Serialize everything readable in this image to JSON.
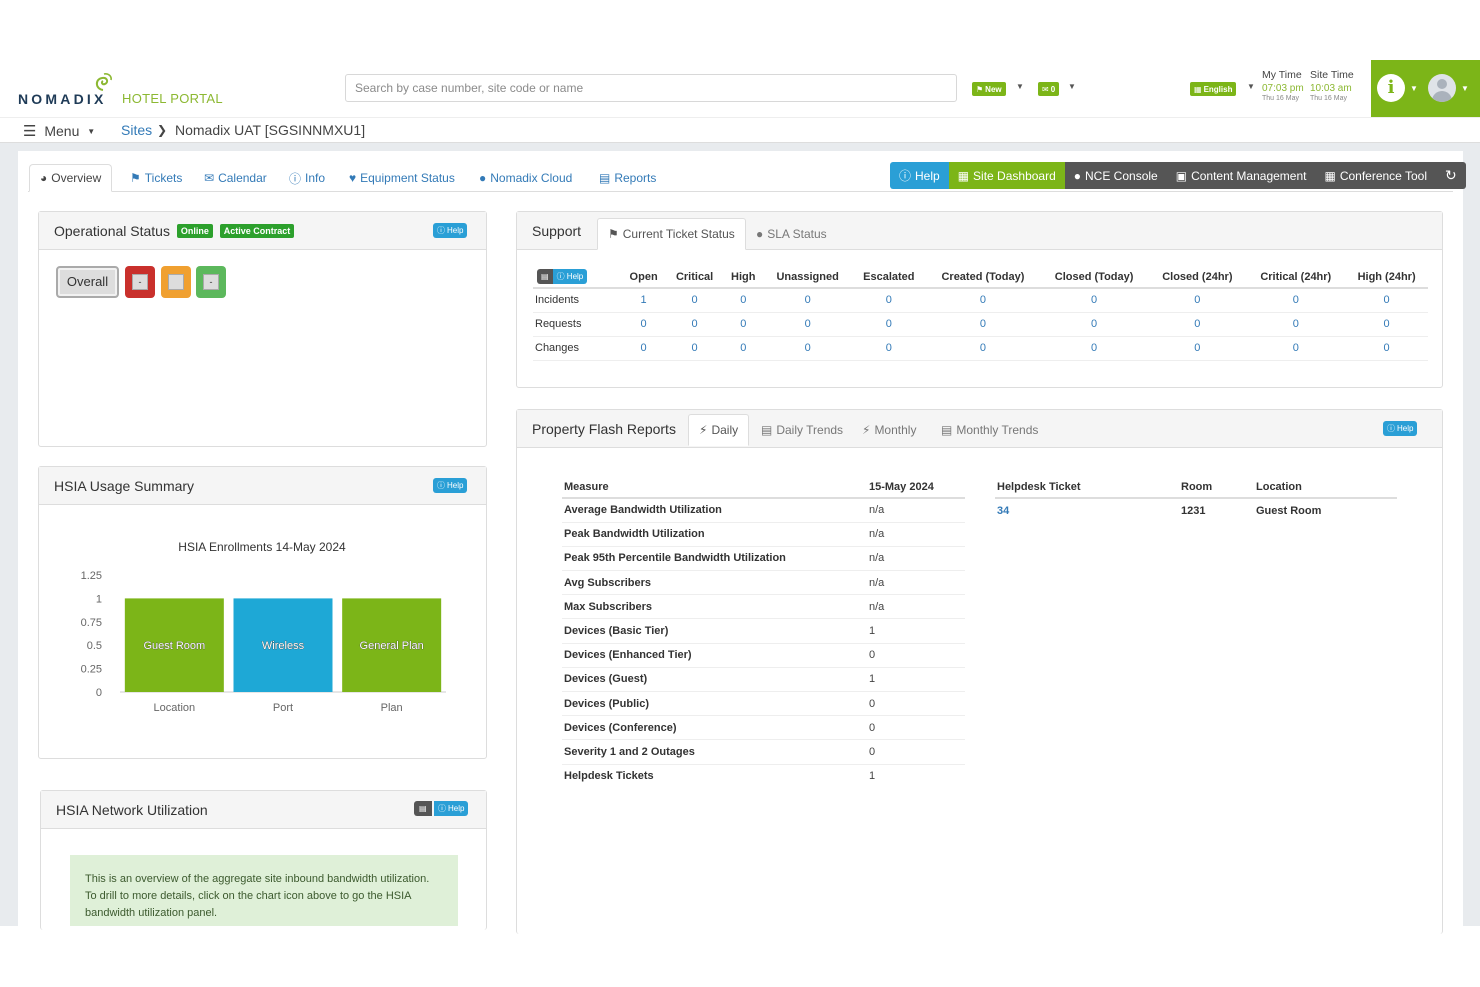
{
  "header": {
    "logo_main": "NOMADIX",
    "logo_sub": "HOTEL PORTAL",
    "search_placeholder": "Search by case number, site code or name",
    "new_label": "New",
    "mail_count": "0",
    "language": "English",
    "my_time_label": "My Time",
    "site_time_label": "Site Time",
    "my_time": "07:03 pm",
    "site_time": "10:03 am",
    "my_day": "Thu 16 May",
    "site_day": "Thu 16 May",
    "info_glyph": "i"
  },
  "breadcrumb": {
    "menu_label": "Menu",
    "sites_label": "Sites",
    "current": "Nomadix UAT [SGSINNMXU1]"
  },
  "tabs": [
    {
      "label": "Overview",
      "icon": "dashboard-icon"
    },
    {
      "label": "Tickets",
      "icon": "flag-icon"
    },
    {
      "label": "Calendar",
      "icon": "bell-icon"
    },
    {
      "label": "Info",
      "icon": "info-icon"
    },
    {
      "label": "Equipment Status",
      "icon": "heart-icon"
    },
    {
      "label": "Nomadix Cloud",
      "icon": "globe-icon"
    },
    {
      "label": "Reports",
      "icon": "chart-icon"
    }
  ],
  "action_buttons": [
    {
      "label": "Help",
      "color": "#2a9fd6"
    },
    {
      "label": "Site Dashboard",
      "color": "#7cb518"
    },
    {
      "label": "NCE Console",
      "color": "#555555"
    },
    {
      "label": "Content Management",
      "color": "#555555"
    },
    {
      "label": "Conference Tool",
      "color": "#555555"
    }
  ],
  "help_label": "Help",
  "operational_status": {
    "title": "Operational Status",
    "badge_online": "Online",
    "badge_contract": "Active Contract",
    "overall_label": "Overall",
    "red_label": "-",
    "orange_label": "-",
    "green_label": "-",
    "colors": {
      "red": "#c9302c",
      "orange": "#f0a030",
      "green": "#5cb85c"
    }
  },
  "support": {
    "title": "Support",
    "tab_current": "Current Ticket Status",
    "tab_sla": "SLA Status",
    "columns": [
      "Open",
      "Critical",
      "High",
      "Unassigned",
      "Escalated",
      "Created (Today)",
      "Closed (Today)",
      "Closed (24hr)",
      "Critical (24hr)",
      "High (24hr)"
    ],
    "rows": [
      {
        "label": "Incidents",
        "values": [
          "1",
          "0",
          "0",
          "0",
          "0",
          "0",
          "0",
          "0",
          "0",
          "0"
        ]
      },
      {
        "label": "Requests",
        "values": [
          "0",
          "0",
          "0",
          "0",
          "0",
          "0",
          "0",
          "0",
          "0",
          "0"
        ]
      },
      {
        "label": "Changes",
        "values": [
          "0",
          "0",
          "0",
          "0",
          "0",
          "0",
          "0",
          "0",
          "0",
          "0"
        ]
      }
    ]
  },
  "hsia_usage": {
    "title": "HSIA Usage Summary",
    "chart_title": "HSIA Enrollments 14-May 2024"
  },
  "chart_data": {
    "type": "bar",
    "title": "HSIA Enrollments 14-May 2024",
    "categories": [
      "Location",
      "Port",
      "Plan"
    ],
    "values": [
      1,
      1,
      1
    ],
    "bar_labels": [
      "Guest Room",
      "Wireless",
      "General Plan"
    ],
    "bar_colors": [
      "#7cb518",
      "#1ea8d6",
      "#7cb518"
    ],
    "yticks": [
      "0",
      "0.25",
      "0.5",
      "0.75",
      "1",
      "1.25"
    ],
    "ylim": [
      0,
      1.25
    ],
    "grid": false,
    "legend": "none"
  },
  "hsia_network": {
    "title": "HSIA Network Utilization",
    "note": "This is an overview of the aggregate site inbound bandwidth utilization. To drill to more details, click on the chart icon above to go the HSIA bandwidth utilization panel."
  },
  "flash": {
    "title": "Property Flash Reports",
    "tabs": [
      "Daily",
      "Daily Trends",
      "Monthly",
      "Monthly Trends"
    ],
    "measure_header": "Measure",
    "date_header": "15-May 2024",
    "rows": [
      {
        "measure": "Average Bandwidth Utilization",
        "value": "n/a"
      },
      {
        "measure": "Peak Bandwidth Utilization",
        "value": "n/a"
      },
      {
        "measure": "Peak 95th Percentile Bandwidth Utilization",
        "value": "n/a"
      },
      {
        "measure": "Avg Subscribers",
        "value": "n/a"
      },
      {
        "measure": "Max Subscribers",
        "value": "n/a"
      },
      {
        "measure": "Devices (Basic Tier)",
        "value": "1"
      },
      {
        "measure": "Devices (Enhanced Tier)",
        "value": "0"
      },
      {
        "measure": "Devices (Guest)",
        "value": "1"
      },
      {
        "measure": "Devices (Public)",
        "value": "0"
      },
      {
        "measure": "Devices (Conference)",
        "value": "0"
      },
      {
        "measure": "Severity 1 and 2 Outages",
        "value": "0"
      },
      {
        "measure": "Helpdesk Tickets",
        "value": "1"
      }
    ],
    "helpdesk_headers": [
      "Helpdesk Ticket",
      "Room",
      "Location"
    ],
    "helpdesk_rows": [
      {
        "ticket": "34",
        "room": "1231",
        "location": "Guest Room"
      }
    ]
  }
}
